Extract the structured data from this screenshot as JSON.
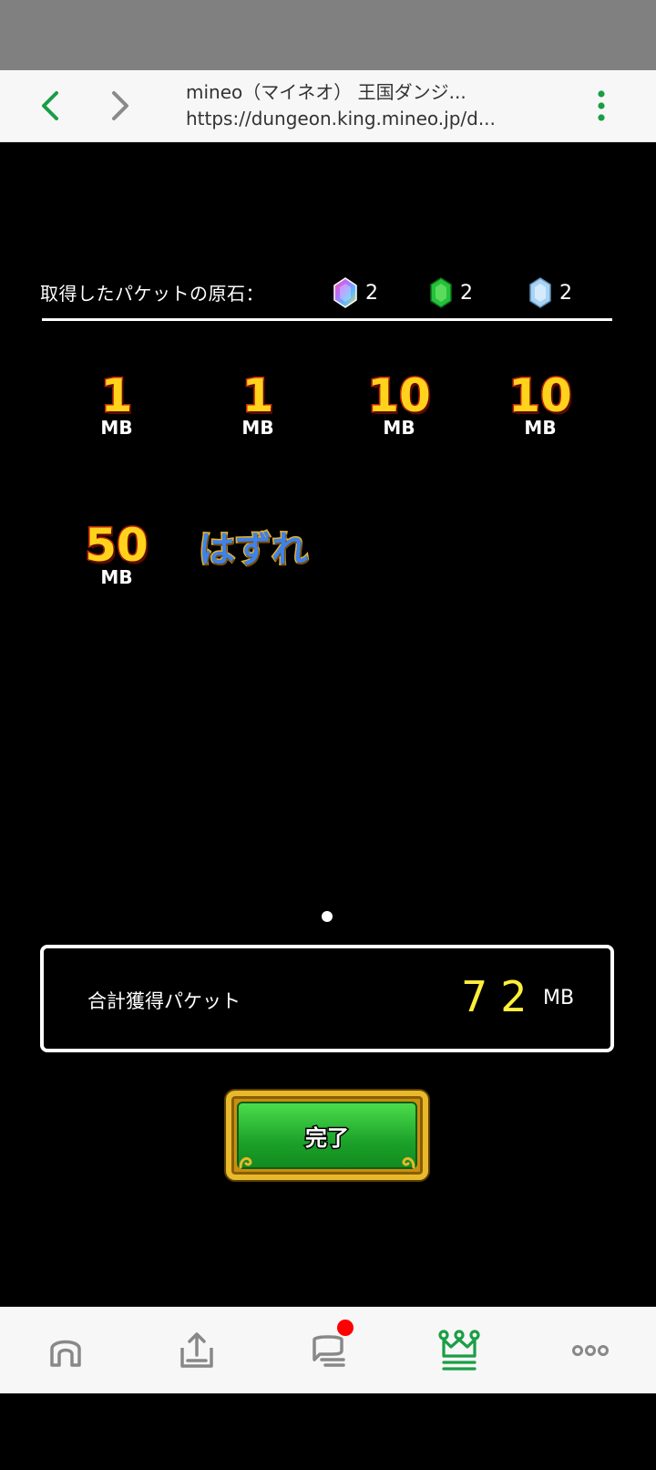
{
  "browser": {
    "page_title": "mineo（マイネオ） 王国ダンジ...",
    "url": "https://dungeon.king.mineo.jp/d..."
  },
  "game": {
    "gems_label": "取得したパケットの原石：",
    "gems": [
      {
        "icon": "rainbow-gem-icon",
        "count": "2"
      },
      {
        "icon": "green-gem-icon",
        "count": "2"
      },
      {
        "icon": "blue-gem-icon",
        "count": "2"
      }
    ],
    "prizes": [
      {
        "value": "1",
        "unit": "MB"
      },
      {
        "value": "1",
        "unit": "MB"
      },
      {
        "value": "10",
        "unit": "MB"
      },
      {
        "value": "10",
        "unit": "MB"
      },
      {
        "value": "50",
        "unit": "MB"
      }
    ],
    "miss_label": "はずれ",
    "total_label": "合計獲得パケット",
    "total_value": "72",
    "total_unit": "MB",
    "done_label": "完了"
  },
  "bottom_nav": {
    "tabs": [
      "home-icon",
      "upload-icon",
      "chat-icon",
      "kingdom-crown-icon",
      "more-icon"
    ],
    "active_tab": "kingdom-crown-icon",
    "colors": {
      "accent": "#1a9e45",
      "inactive": "#888888",
      "badge": "#ff0000"
    }
  }
}
